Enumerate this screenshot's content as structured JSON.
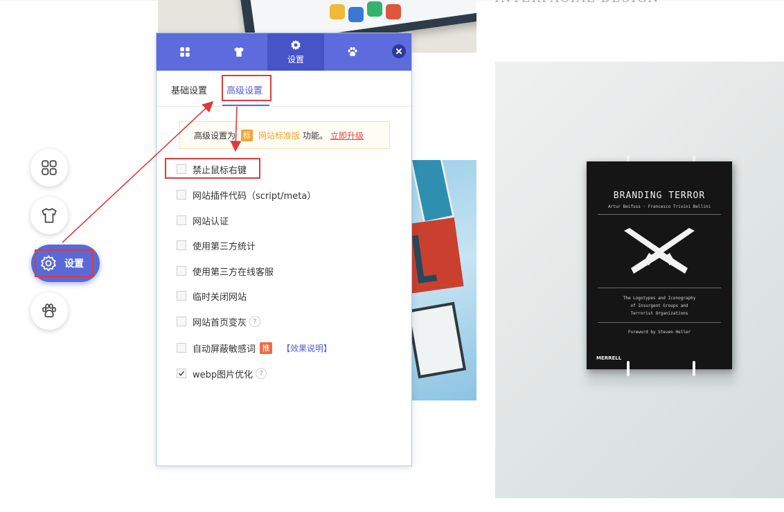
{
  "background": {
    "heading_partial": "INTERFACIAL DESIGN",
    "book": {
      "title": "BRANDING TERROR",
      "authors": "Artur Beifuss · Francesco Trivini Bellini",
      "subtitle_lines": [
        "The Logotypes and Iconography",
        "of Insurgent Groups and",
        "Terrorist Organizations"
      ],
      "foreword": "Foreword by Steven Heller",
      "publisher": "MERRELL"
    }
  },
  "float_toolbar": {
    "items": [
      {
        "icon": "grid-icon",
        "label": ""
      },
      {
        "icon": "shirt-icon",
        "label": ""
      },
      {
        "icon": "gear-icon",
        "label": "设置"
      },
      {
        "icon": "paw-icon",
        "label": ""
      }
    ],
    "active_index": 2
  },
  "panel": {
    "tabs": [
      {
        "icon": "grid-icon",
        "label": ""
      },
      {
        "icon": "shirt-icon",
        "label": ""
      },
      {
        "icon": "gear-icon",
        "label": "设置"
      },
      {
        "icon": "paw-icon",
        "label": ""
      }
    ],
    "active_tab": 2,
    "close_icon": "close-icon",
    "subtabs": [
      "基础设置",
      "高级设置"
    ],
    "active_subtab": 1,
    "notice": {
      "prefix": "高级设置为",
      "badge": "标",
      "edition": "网站标准版",
      "suffix": "功能。",
      "upgrade_link": "立即升级"
    },
    "options": [
      {
        "label": "禁止鼠标右键",
        "checked": false
      },
      {
        "label": "网站插件代码（script/meta）",
        "checked": false
      },
      {
        "label": "网站认证",
        "checked": false
      },
      {
        "label": "使用第三方统计",
        "checked": false
      },
      {
        "label": "使用第三方在线客服",
        "checked": false
      },
      {
        "label": "临时关闭网站",
        "checked": false
      },
      {
        "label": "网站首页变灰",
        "checked": false,
        "help": "?"
      },
      {
        "label": "自动屏蔽敏感词",
        "checked": false,
        "tag": "推",
        "link": "【效果说明】"
      },
      {
        "label": "webp图片优化",
        "checked": true,
        "help": "?"
      }
    ]
  },
  "colors": {
    "accent": "#5d6bdc",
    "accent_dark": "#4654c8",
    "annotation_red": "#e03a3a",
    "badge_orange": "#f3a533",
    "hot_tag": "#f06a40",
    "upgrade_red": "#e8413d"
  }
}
